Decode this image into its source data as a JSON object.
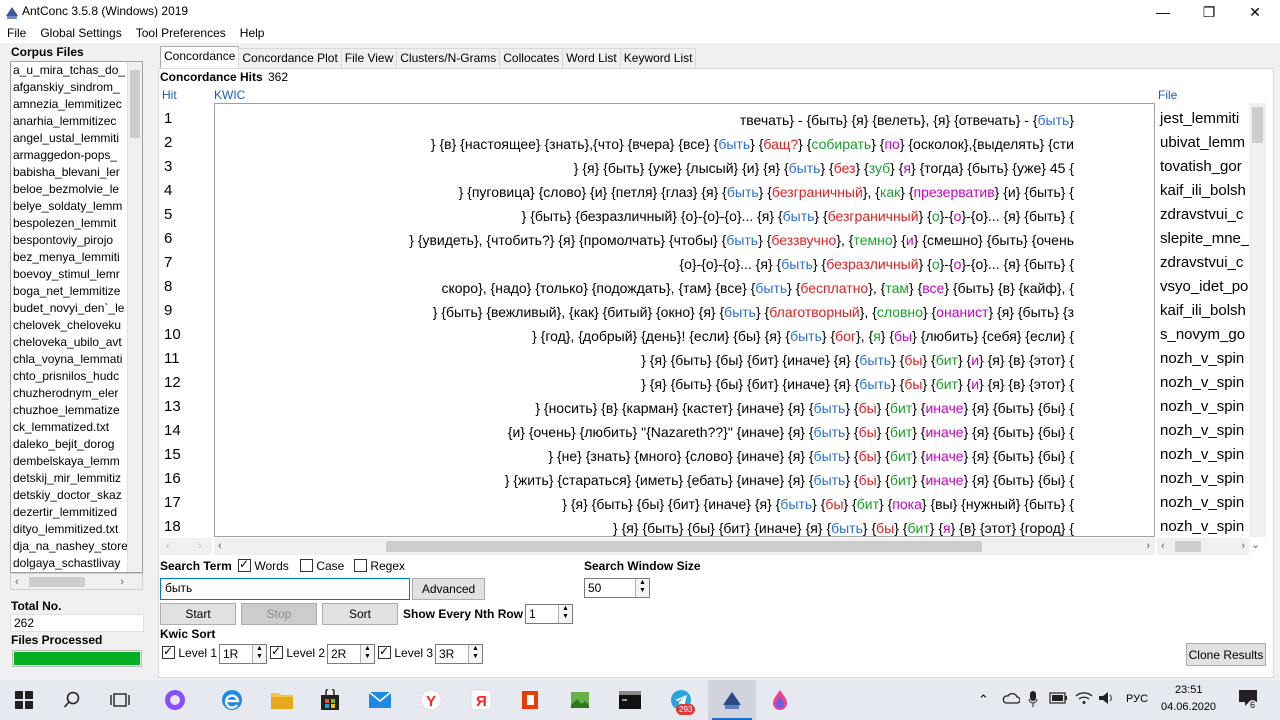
{
  "window": {
    "title": "AntConc 3.5.8 (Windows) 2019"
  },
  "menu": [
    "File",
    "Global Settings",
    "Tool Preferences",
    "Help"
  ],
  "sidebar": {
    "corpus_files_label": "Corpus Files",
    "files": [
      "a_u_mira_tchas_do_",
      "afganskiy_sindrom_",
      "amnezia_lemmitizec",
      "anarhia_lemmitizec",
      "angel_ustal_lemmiti",
      "armaggedon-pops_",
      "babisha_blevani_ler",
      "beloe_bezmolvie_le",
      "belye_soldaty_lemm",
      "bespolezen_lemmit",
      "bespontoviy_pirojo",
      "bez_menya_lemmiti",
      "boevoy_stimul_lemr",
      "boga_net_lemmitize",
      "budet_novyi_den`_le",
      "chelovek_cheloveku",
      "cheloveka_ubilo_avt",
      "chla_voyna_lemmati",
      "chto_prisnilos_hudc",
      "chuzherodnym_eler",
      "chuzhoe_lemmatize",
      "ck_lemmatized.txt",
      "daleko_bejit_dorog",
      "dembelskaya_lemm",
      "detskij_mir_lemmitiz",
      "detskiy_doctor_skaz",
      "dezertir_lemmitized",
      "dityo_lemmitized.txt",
      "dja_na_nashey_store",
      "dolgaya_schastlivay"
    ],
    "total_no_label": "Total No.",
    "total_no_value": "262",
    "files_processed_label": "Files Processed",
    "files_processed_fraction": 1.0
  },
  "tabs": [
    "Concordance",
    "Concordance Plot",
    "File View",
    "Clusters/N-Grams",
    "Collocates",
    "Word List",
    "Keyword List"
  ],
  "concordance": {
    "hits_label": "Concordance Hits",
    "hits_value": "362",
    "col_hit": "Hit",
    "col_kwic": "KWIC",
    "col_file": "File",
    "rows": [
      {
        "n": "1",
        "segments": [
          {
            "t": "твечать} - {быть} {я} {велеть}, {я} {отвечать} - {",
            "c": ""
          },
          {
            "t": "быть",
            "c": "blue"
          },
          {
            "t": "}",
            "c": ""
          }
        ],
        "file": "jest_lemmiti"
      },
      {
        "n": "2",
        "segments": [
          {
            "t": "} {в} {настоящее} {знать},{что} {вчера} {все} {",
            "c": ""
          },
          {
            "t": "быть",
            "c": "blue"
          },
          {
            "t": "} {",
            "c": ""
          },
          {
            "t": "бащ?",
            "c": "red"
          },
          {
            "t": "} {",
            "c": ""
          },
          {
            "t": "собирать",
            "c": "green"
          },
          {
            "t": "} {",
            "c": ""
          },
          {
            "t": "по",
            "c": "mag"
          },
          {
            "t": "} {осколок},{выделять} {сти",
            "c": ""
          }
        ],
        "file": "ubivat_lemm"
      },
      {
        "n": "3",
        "segments": [
          {
            "t": "} {я} {быть} {уже} {лысый} {и} {я} {",
            "c": ""
          },
          {
            "t": "быть",
            "c": "blue"
          },
          {
            "t": "} {",
            "c": ""
          },
          {
            "t": "без",
            "c": "red"
          },
          {
            "t": "} {",
            "c": ""
          },
          {
            "t": "зуб",
            "c": "green"
          },
          {
            "t": "} {",
            "c": ""
          },
          {
            "t": "я",
            "c": "mag"
          },
          {
            "t": "} {тогда} {быть} {уже} 45 {",
            "c": ""
          }
        ],
        "file": "tovatish_gor"
      },
      {
        "n": "4",
        "segments": [
          {
            "t": "} {пуговица} {слово} {и} {петля} {глаз} {я} {",
            "c": ""
          },
          {
            "t": "быть",
            "c": "blue"
          },
          {
            "t": "} {",
            "c": ""
          },
          {
            "t": "безграничный",
            "c": "red"
          },
          {
            "t": "}, {",
            "c": ""
          },
          {
            "t": "как",
            "c": "green"
          },
          {
            "t": "} {",
            "c": ""
          },
          {
            "t": "презерватив",
            "c": "mag"
          },
          {
            "t": "} {и} {быть} {",
            "c": ""
          }
        ],
        "file": "kaif_ili_bolsh"
      },
      {
        "n": "5",
        "segments": [
          {
            "t": "} {быть} {безразличный} {о}-{о}-{о}... {я} {",
            "c": ""
          },
          {
            "t": "быть",
            "c": "blue"
          },
          {
            "t": "} {",
            "c": ""
          },
          {
            "t": "безграничный",
            "c": "red"
          },
          {
            "t": "} {",
            "c": ""
          },
          {
            "t": "о",
            "c": "green"
          },
          {
            "t": "}-{",
            "c": ""
          },
          {
            "t": "о",
            "c": "mag"
          },
          {
            "t": "}-{о}... {я} {быть} {",
            "c": ""
          }
        ],
        "file": "zdravstvui_c"
      },
      {
        "n": "6",
        "segments": [
          {
            "t": "} {увидеть}, {чтобить?} {я} {промолчать} {чтобы} {",
            "c": ""
          },
          {
            "t": "быть",
            "c": "blue"
          },
          {
            "t": "} {",
            "c": ""
          },
          {
            "t": "беззвучно",
            "c": "red"
          },
          {
            "t": "}, {",
            "c": ""
          },
          {
            "t": "темно",
            "c": "green"
          },
          {
            "t": "} {",
            "c": ""
          },
          {
            "t": "и",
            "c": "mag"
          },
          {
            "t": "} {смешно} {быть} {очень",
            "c": ""
          }
        ],
        "file": "slepite_mne_"
      },
      {
        "n": "7",
        "segments": [
          {
            "t": "{о}-{о}-{о}... {я} {",
            "c": ""
          },
          {
            "t": "быть",
            "c": "blue"
          },
          {
            "t": "} {",
            "c": ""
          },
          {
            "t": "безразличный",
            "c": "red"
          },
          {
            "t": "} {",
            "c": ""
          },
          {
            "t": "о",
            "c": "green"
          },
          {
            "t": "}-{",
            "c": ""
          },
          {
            "t": "о",
            "c": "mag"
          },
          {
            "t": "}-{о}... {я} {быть} {",
            "c": ""
          }
        ],
        "file": "zdravstvui_c"
      },
      {
        "n": "8",
        "segments": [
          {
            "t": "скоро}, {надо} {только} {подождать}, {там} {все} {",
            "c": ""
          },
          {
            "t": "быть",
            "c": "blue"
          },
          {
            "t": "} {",
            "c": ""
          },
          {
            "t": "бесплатно",
            "c": "red"
          },
          {
            "t": "}, {",
            "c": ""
          },
          {
            "t": "там",
            "c": "green"
          },
          {
            "t": "} {",
            "c": ""
          },
          {
            "t": "все",
            "c": "mag"
          },
          {
            "t": "} {быть} {в} {кайф}, {",
            "c": ""
          }
        ],
        "file": "vsyo_idet_po"
      },
      {
        "n": "9",
        "segments": [
          {
            "t": "} {быть} {вежливый}, {как} {битый} {окно} {я} {",
            "c": ""
          },
          {
            "t": "быть",
            "c": "blue"
          },
          {
            "t": "} {",
            "c": ""
          },
          {
            "t": "благотворный",
            "c": "red"
          },
          {
            "t": "}, {",
            "c": ""
          },
          {
            "t": "словно",
            "c": "green"
          },
          {
            "t": "} {",
            "c": ""
          },
          {
            "t": "онанист",
            "c": "mag"
          },
          {
            "t": "} {я} {быть} {з",
            "c": ""
          }
        ],
        "file": "kaif_ili_bolsh"
      },
      {
        "n": "10",
        "segments": [
          {
            "t": "} {год}, {добрый} {день}! {если} {бы} {я} {",
            "c": ""
          },
          {
            "t": "быть",
            "c": "blue"
          },
          {
            "t": "} {",
            "c": ""
          },
          {
            "t": "бог",
            "c": "red"
          },
          {
            "t": "}, {",
            "c": ""
          },
          {
            "t": "я",
            "c": "green"
          },
          {
            "t": "} {",
            "c": ""
          },
          {
            "t": "бы",
            "c": "mag"
          },
          {
            "t": "} {любить} {себя} {если} {",
            "c": ""
          }
        ],
        "file": "s_novym_go"
      },
      {
        "n": "11",
        "segments": [
          {
            "t": "} {я} {быть} {бы} {бит} {иначе} {я} {",
            "c": ""
          },
          {
            "t": "быть",
            "c": "blue"
          },
          {
            "t": "} {",
            "c": ""
          },
          {
            "t": "бы",
            "c": "red"
          },
          {
            "t": "} {",
            "c": ""
          },
          {
            "t": "бит",
            "c": "green"
          },
          {
            "t": "} {",
            "c": ""
          },
          {
            "t": "и",
            "c": "mag"
          },
          {
            "t": "} {я} {в} {этот} {",
            "c": ""
          }
        ],
        "file": "nozh_v_spin"
      },
      {
        "n": "12",
        "segments": [
          {
            "t": "} {я} {быть} {бы} {бит} {иначе} {я} {",
            "c": ""
          },
          {
            "t": "быть",
            "c": "blue"
          },
          {
            "t": "} {",
            "c": ""
          },
          {
            "t": "бы",
            "c": "red"
          },
          {
            "t": "} {",
            "c": ""
          },
          {
            "t": "бит",
            "c": "green"
          },
          {
            "t": "} {",
            "c": ""
          },
          {
            "t": "и",
            "c": "mag"
          },
          {
            "t": "} {я} {в} {этот} {",
            "c": ""
          }
        ],
        "file": "nozh_v_spin"
      },
      {
        "n": "13",
        "segments": [
          {
            "t": "} {носить} {в} {карман} {кастет} {иначе} {я} {",
            "c": ""
          },
          {
            "t": "быть",
            "c": "blue"
          },
          {
            "t": "} {",
            "c": ""
          },
          {
            "t": "бы",
            "c": "red"
          },
          {
            "t": "} {",
            "c": ""
          },
          {
            "t": "бит",
            "c": "green"
          },
          {
            "t": "} {",
            "c": ""
          },
          {
            "t": "иначе",
            "c": "mag"
          },
          {
            "t": "} {я} {быть} {бы} {",
            "c": ""
          }
        ],
        "file": "nozh_v_spin"
      },
      {
        "n": "14",
        "segments": [
          {
            "t": "{и} {очень} {любить} \"{Nazareth??}\" {иначе} {я} {",
            "c": ""
          },
          {
            "t": "быть",
            "c": "blue"
          },
          {
            "t": "} {",
            "c": ""
          },
          {
            "t": "бы",
            "c": "red"
          },
          {
            "t": "} {",
            "c": ""
          },
          {
            "t": "бит",
            "c": "green"
          },
          {
            "t": "} {",
            "c": ""
          },
          {
            "t": "иначе",
            "c": "mag"
          },
          {
            "t": "} {я} {быть} {бы} {",
            "c": ""
          }
        ],
        "file": "nozh_v_spin"
      },
      {
        "n": "15",
        "segments": [
          {
            "t": "} {не} {знать} {много} {слово} {иначе} {я} {",
            "c": ""
          },
          {
            "t": "быть",
            "c": "blue"
          },
          {
            "t": "} {",
            "c": ""
          },
          {
            "t": "бы",
            "c": "red"
          },
          {
            "t": "} {",
            "c": ""
          },
          {
            "t": "бит",
            "c": "green"
          },
          {
            "t": "} {",
            "c": ""
          },
          {
            "t": "иначе",
            "c": "mag"
          },
          {
            "t": "} {я} {быть} {бы} {",
            "c": ""
          }
        ],
        "file": "nozh_v_spin"
      },
      {
        "n": "16",
        "segments": [
          {
            "t": "} {жить} {стараться} {иметь} {ебать} {иначе} {я} {",
            "c": ""
          },
          {
            "t": "быть",
            "c": "blue"
          },
          {
            "t": "} {",
            "c": ""
          },
          {
            "t": "бы",
            "c": "red"
          },
          {
            "t": "} {",
            "c": ""
          },
          {
            "t": "бит",
            "c": "green"
          },
          {
            "t": "} {",
            "c": ""
          },
          {
            "t": "иначе",
            "c": "mag"
          },
          {
            "t": "} {я} {быть} {бы} {",
            "c": ""
          }
        ],
        "file": "nozh_v_spin"
      },
      {
        "n": "17",
        "segments": [
          {
            "t": "} {я} {быть} {бы} {бит} {иначе} {я} {",
            "c": ""
          },
          {
            "t": "быть",
            "c": "blue"
          },
          {
            "t": "} {",
            "c": ""
          },
          {
            "t": "бы",
            "c": "red"
          },
          {
            "t": "} {",
            "c": ""
          },
          {
            "t": "бит",
            "c": "green"
          },
          {
            "t": "} {",
            "c": ""
          },
          {
            "t": "пока",
            "c": "mag"
          },
          {
            "t": "} {вы} {нужный} {быть} {",
            "c": ""
          }
        ],
        "file": "nozh_v_spin"
      },
      {
        "n": "18",
        "segments": [
          {
            "t": "} {я} {быть} {бы} {бит} {иначе} {я} {",
            "c": ""
          },
          {
            "t": "быть",
            "c": "blue"
          },
          {
            "t": "} {",
            "c": ""
          },
          {
            "t": "бы",
            "c": "red"
          },
          {
            "t": "} {",
            "c": ""
          },
          {
            "t": "бит",
            "c": "green"
          },
          {
            "t": "} {",
            "c": ""
          },
          {
            "t": "я",
            "c": "mag"
          },
          {
            "t": "} {в} {этот} {город} {",
            "c": ""
          }
        ],
        "file": "nozh_v_spin"
      }
    ]
  },
  "search": {
    "search_term_label": "Search Term",
    "words_label": "Words",
    "words_checked": true,
    "case_label": "Case",
    "case_checked": false,
    "regex_label": "Regex",
    "regex_checked": false,
    "term_value": "быть",
    "advanced_label": "Advanced",
    "window_size_label": "Search Window Size",
    "window_size_value": "50",
    "start_label": "Start",
    "stop_label": "Stop",
    "sort_label": "Sort",
    "nth_row_label": "Show Every Nth Row",
    "nth_row_value": "1"
  },
  "kwic_sort": {
    "label": "Kwic Sort",
    "levels": [
      {
        "label": "Level 1",
        "checked": true,
        "value": "1R"
      },
      {
        "label": "Level 2",
        "checked": true,
        "value": "2R"
      },
      {
        "label": "Level 3",
        "checked": true,
        "value": "3R"
      }
    ]
  },
  "clone_results_label": "Clone Results",
  "taskbar": {
    "language": "РУС",
    "time": "23:51",
    "date": "04.06.2020",
    "telegram_badge": "293",
    "notification_count": "6"
  },
  "colors": {
    "blue": "#2a6fdb",
    "red": "#e02020",
    "green": "#18a02a",
    "magenta": "#c800c8",
    "progress": "#06b025"
  }
}
